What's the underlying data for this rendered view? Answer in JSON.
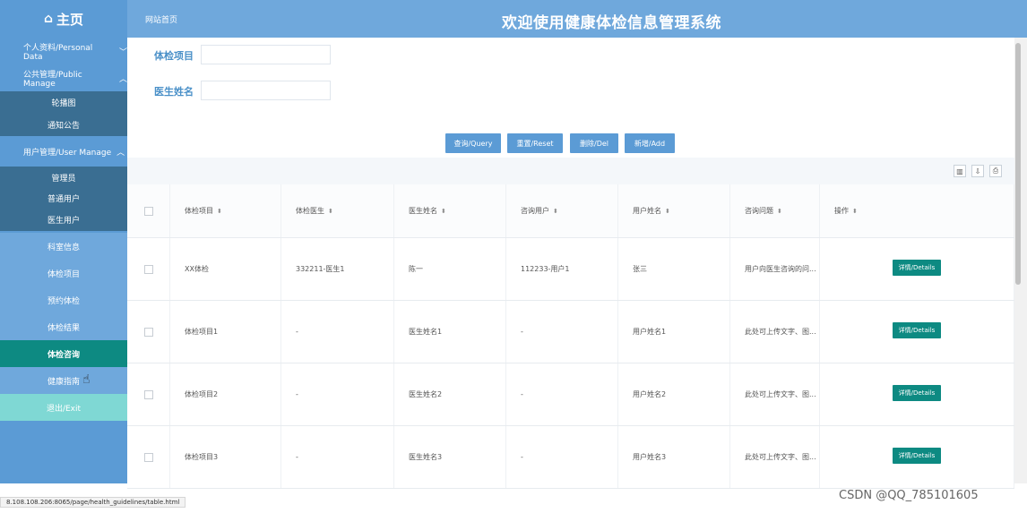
{
  "header": {
    "home_label": "主页",
    "breadcrumb": "网站首页",
    "title": "欢迎使用健康体检信息管理系统"
  },
  "sidebar": {
    "personal": "个人资料/Personal Data",
    "public_manage": "公共管理/Public Manage",
    "carousel": "轮播图",
    "notice": "通知公告",
    "user_manage": "用户管理/User Manage",
    "admin": "管理员",
    "normal_user": "普通用户",
    "doctor_user": "医生用户",
    "department": "科室信息",
    "exam_item": "体检项目",
    "booking": "预约体检",
    "exam_result": "体检结果",
    "exam_consult": "体检咨询",
    "health_guide": "健康指南",
    "exit": "退出/Exit"
  },
  "search": {
    "item_label": "体检项目",
    "doctor_label": "医生姓名",
    "query_btn": "查询/Query",
    "reset_btn": "重置/Reset",
    "delete_btn": "删除/Del",
    "add_btn": "新增/Add"
  },
  "table": {
    "headers": [
      "体检项目",
      "体检医生",
      "医生姓名",
      "咨询用户",
      "用户姓名",
      "咨询问题",
      "操作"
    ],
    "sort_icon": "sort-icon",
    "details_label": "详情/Details",
    "rows": [
      [
        "XX体检",
        "332211-医生1",
        "陈一",
        "112233-用户1",
        "张三",
        "用户向医生咨询的问..."
      ],
      [
        "体检项目1",
        "-",
        "医生姓名1",
        "-",
        "用户姓名1",
        "此处可上传文字、图..."
      ],
      [
        "体检项目2",
        "-",
        "医生姓名2",
        "-",
        "用户姓名2",
        "此处可上传文字、图..."
      ],
      [
        "体检项目3",
        "-",
        "医生姓名3",
        "-",
        "用户姓名3",
        "此处可上传文字、图..."
      ]
    ]
  },
  "footer": {
    "status_url": "8.108.108.206:8065/page/health_guidelines/table.html",
    "watermark": "CSDN @QQ_785101605"
  },
  "colors": {
    "topbar": "#6fa8dc",
    "sidebar": "#5b9bd5",
    "submenu": "#3a6e92",
    "active": "#0d8a82",
    "exit": "#7fd8d4"
  }
}
